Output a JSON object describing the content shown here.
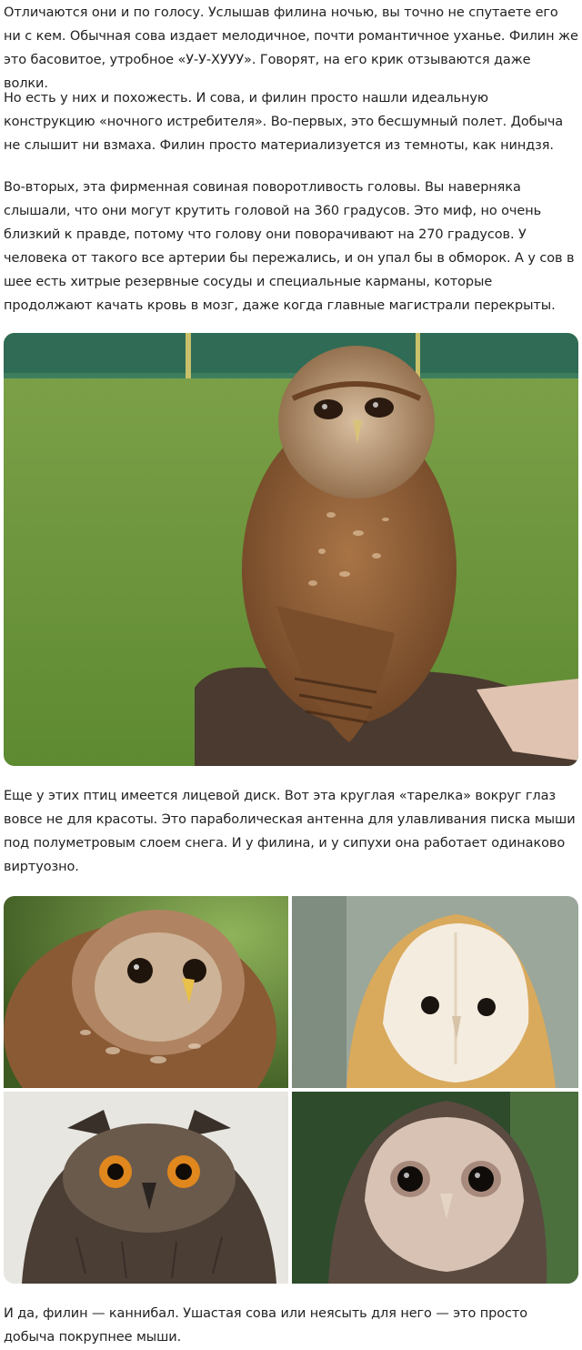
{
  "paragraphs": [
    "Отличаются они и по голосу. Услышав филина ночью, вы точно не спутаете его ни с кем. Обычная сова издает мелодичное, почти романтичное уханье. Филин же это басовитое, утробное «У-У-ХУУУ». Говорят, на его крик отзываются даже волки.",
    "Но есть у них и похожесть. И сова, и филин просто нашли идеальную конструкцию «ночного истребителя». Во-первых, это бесшумный полет. Добыча не слышит ни взмаха. Филин просто материализуется из темноты, как ниндзя.",
    "Во-вторых, эта фирменная совиная поворотливость головы. Вы наверняка слышали, что они могут крутить головой на 360 градусов. Это миф, но очень близкий к правде, потому что голову они поворачивают на 270 градусов. У человека от такого все артерии бы пережались, и он упал бы в обморок. А у сов в шее есть хитрые резервные сосуды и специальные карманы, которые продолжают качать кровь в мозг, даже когда главные магистрали перекрыты.",
    "Еще у этих птиц имеется лицевой диск. Вот эта круглая «тарелка» вокруг глаз вовсе не для красоты. Это параболическая антенна для улавливания писка мыши под полуметровым слоем снега. И у филина, и у сипухи она работает одинаково виртуозно.",
    "И да, филин — каннибал. Ушастая сова или неясыть для него — это просто добыча покрупнее мыши."
  ],
  "colors": {
    "text": "#222222",
    "grass": "#6f9a3e",
    "fence": "#2f6b55",
    "owl_brown": "#8a5a34",
    "barn_owl_face": "#f4ecdf",
    "barn_owl_gold": "#d9a95c"
  },
  "images": {
    "main_photo": "tawny-owl-on-glove",
    "grid": [
      "tawny-owl-closeup",
      "barn-owl",
      "eagle-owl",
      "masked-owl"
    ]
  }
}
